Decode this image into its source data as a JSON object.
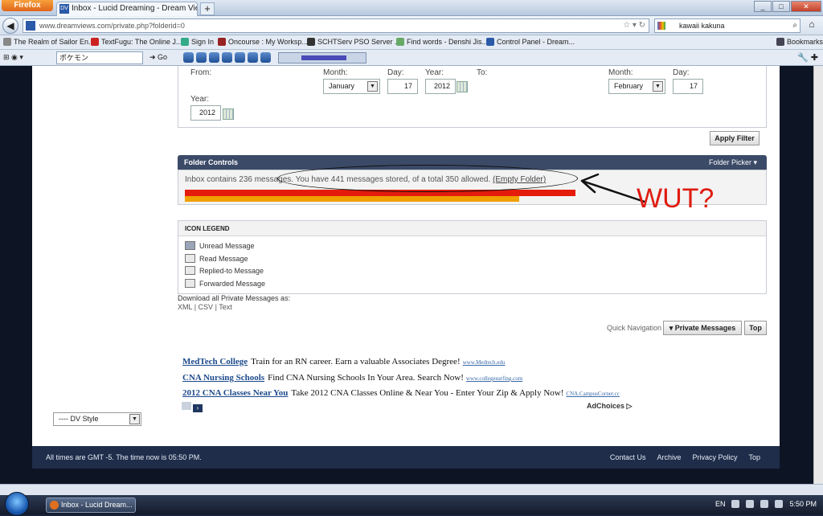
{
  "browser": {
    "menu_button": "Firefox",
    "tab_title": "Inbox - Lucid Dreaming - Dream Views",
    "tab_favicon": "DV",
    "new_tab": "+",
    "url": "www.dreamviews.com/private.php?folderid=0",
    "search_text": "kawaii kakuna",
    "bookmarks": [
      "The Realm of Sailor En...",
      "TextFugu: The Online J...",
      "Sign In",
      "Oncourse : My Worksp...",
      "SCHTServ PSO Server ...",
      "Find words - Denshi Jis...",
      "Control Panel - Dream..."
    ],
    "bookmarks_menu": "Bookmarks",
    "toolbar_search": "ポケモン",
    "toolbar_go": "Go"
  },
  "filter": {
    "from_label": "From:",
    "month_label": "Month:",
    "day_label": "Day:",
    "year_label": "Year:",
    "to_label": "To:",
    "from_month": "January",
    "from_day": "17",
    "from_year": "2012",
    "to_month": "February",
    "to_day": "17",
    "to_year": "2012",
    "apply_button": "Apply Filter"
  },
  "folder_controls": {
    "title": "Folder Controls",
    "picker": "Folder Picker",
    "message_text": "Inbox contains 236 messages. You have 441 messages stored, of a total 350 allowed.",
    "empty_link": "(Empty Folder)",
    "usage_percent": 126
  },
  "annotation": {
    "text": "WUT?",
    "color": "#e01b10"
  },
  "icon_legend": {
    "title": "ICON LEGEND",
    "items": [
      "Unread Message",
      "Read Message",
      "Replied-to Message",
      "Forwarded Message"
    ]
  },
  "download": {
    "label": "Download all Private Messages as:",
    "xml": "XML",
    "csv": "CSV",
    "text": "Text",
    "sep": "|"
  },
  "quick_nav": {
    "label": "Quick Navigation",
    "selected": "Private Messages",
    "top_button": "Top"
  },
  "ads": [
    {
      "title": "MedTech College",
      "body": "Train for an RN career. Earn a valuable Associates Degree!",
      "url": "www.Medtech.edu"
    },
    {
      "title": "CNA Nursing Schools",
      "body": "Find CNA Nursing Schools In Your Area. Search Now!",
      "url": "www.collegesurfing.com"
    },
    {
      "title": "2012 CNA Classes Near You",
      "body": "Take 2012 CNA Classes Online & Near You - Enter Your Zip & Apply Now!",
      "url": "CNA.CampusCorner.cc"
    }
  ],
  "adchoices": "AdChoices",
  "style_select": "---- DV Style",
  "footer": {
    "timezone": "All times are GMT -5. The time now is 05:50 PM.",
    "links": [
      "Contact Us",
      "Archive",
      "Privacy Policy",
      "Top"
    ]
  },
  "taskbar": {
    "task": "Inbox - Lucid Dream...",
    "lang": "EN",
    "clock": "5:50 PM"
  },
  "colors": {
    "header_bg": "#3b4a67",
    "usage_bar_red": "#e31c0c",
    "usage_bar_orange": "#f0a000"
  }
}
